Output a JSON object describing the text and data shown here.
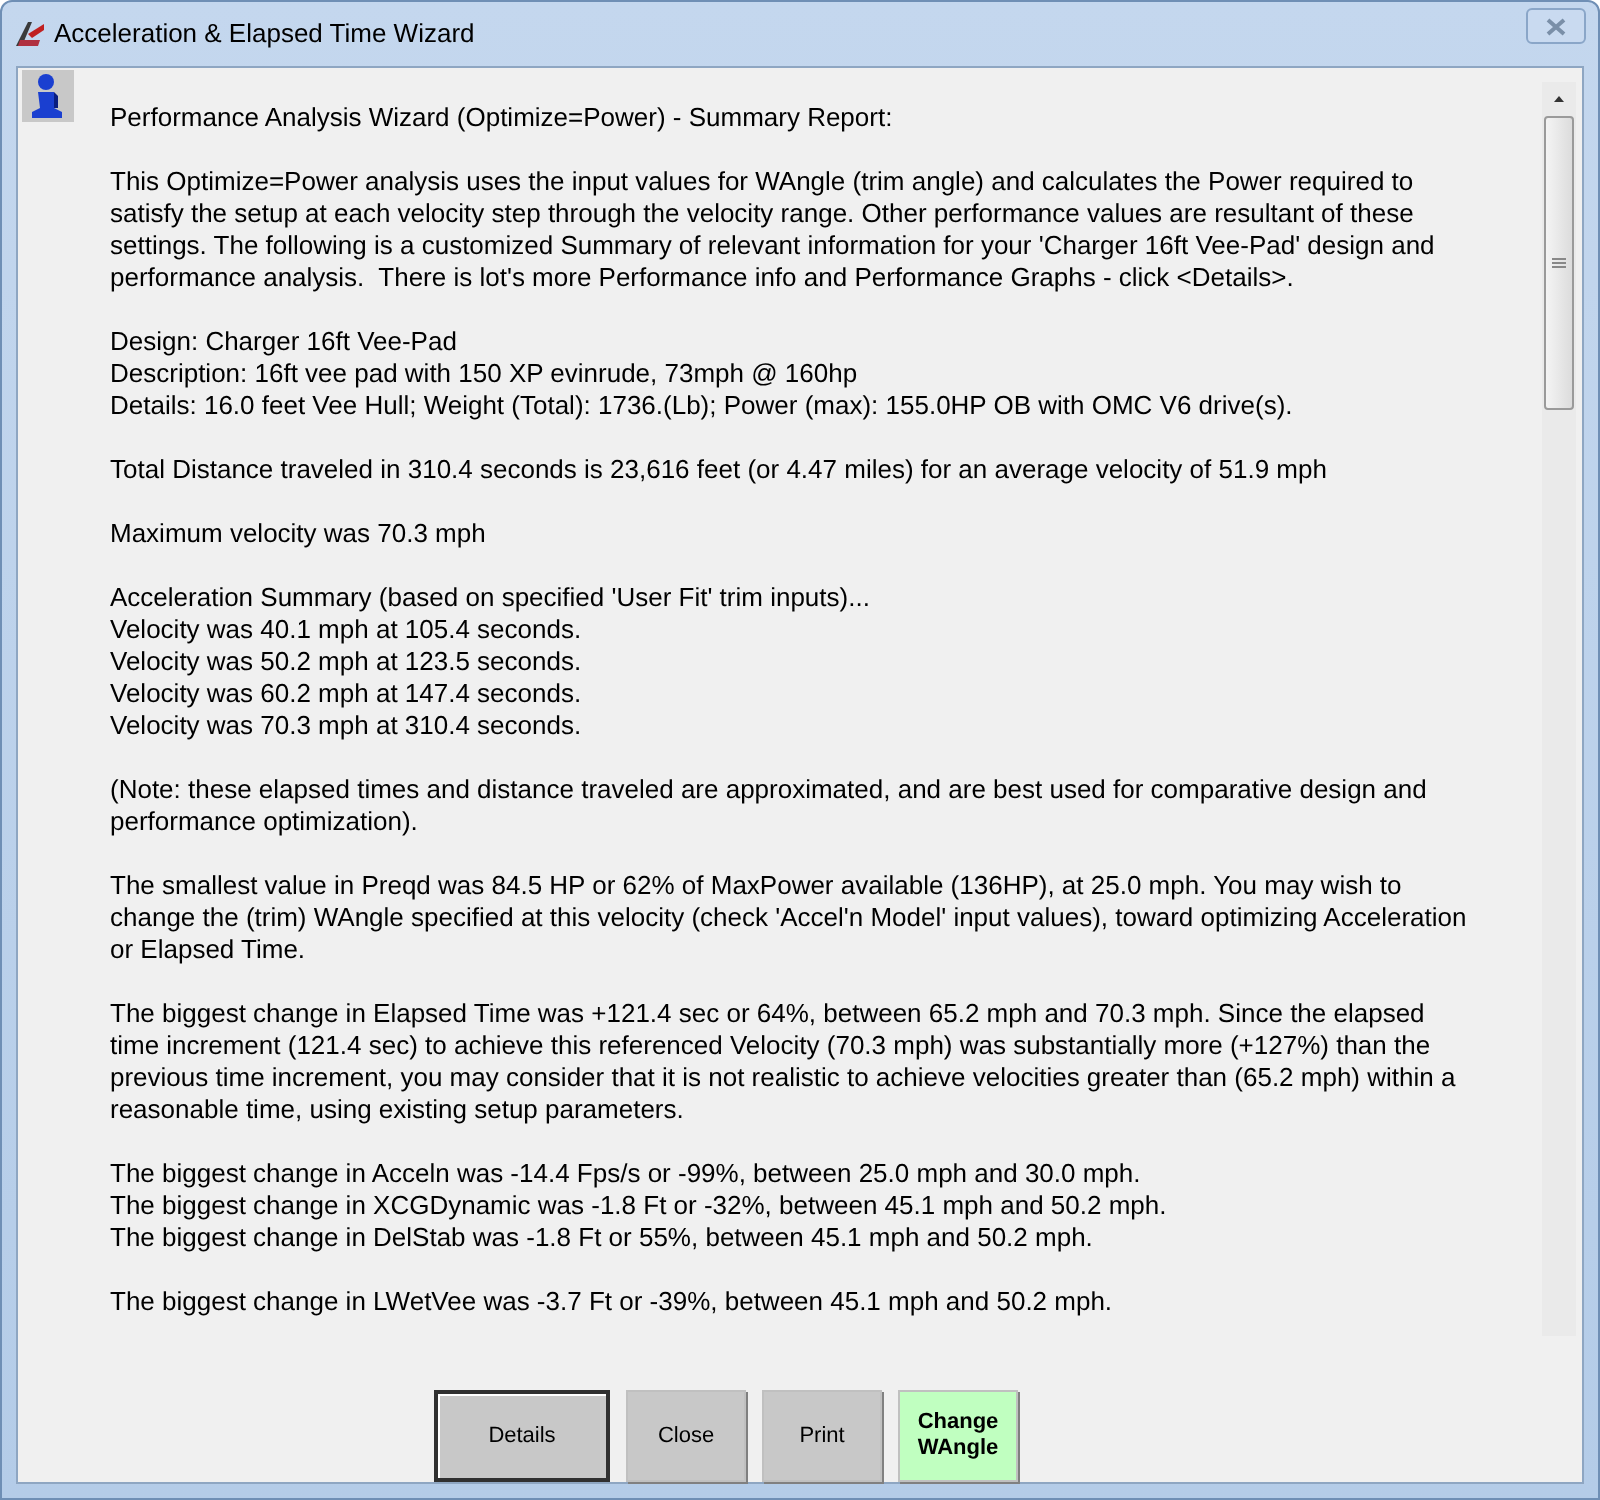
{
  "window": {
    "title": "Acceleration & Elapsed Time Wizard"
  },
  "report": {
    "paragraphs": [
      "Performance Analysis Wizard (Optimize=Power) - Summary Report:",
      "This Optimize=Power analysis uses the input values for WAngle (trim angle) and calculates the Power required to\nsatisfy the setup at each velocity step through the velocity range. Other performance values are resultant of these\nsettings. The following is a customized Summary of relevant information for your 'Charger 16ft Vee-Pad' design and\nperformance analysis.  There is lot's more Performance info and Performance Graphs - click <Details>.",
      "Design: Charger 16ft Vee-Pad\nDescription: 16ft vee pad with 150 XP evinrude, 73mph @ 160hp\nDetails: 16.0 feet Vee Hull; Weight (Total): 1736.(Lb); Power (max): 155.0HP OB with OMC V6 drive(s).",
      "Total Distance traveled in 310.4 seconds is 23,616 feet (or 4.47 miles) for an average velocity of 51.9 mph",
      "Maximum velocity was 70.3 mph",
      "Acceleration Summary (based on specified 'User Fit' trim inputs)...\nVelocity was 40.1 mph at 105.4 seconds.\nVelocity was 50.2 mph at 123.5 seconds.\nVelocity was 60.2 mph at 147.4 seconds.\nVelocity was 70.3 mph at 310.4 seconds.",
      "(Note: these elapsed times and distance traveled are approximated, and are best used for comparative design and\nperformance optimization).",
      "The smallest value in Preqd was 84.5 HP or 62% of MaxPower available (136HP), at 25.0 mph. You may wish to\nchange the (trim) WAngle specified at this velocity (check 'Accel'n Model' input values), toward optimizing Acceleration\nor Elapsed Time.",
      "The biggest change in Elapsed Time was +121.4 sec or 64%, between 65.2 mph and 70.3 mph. Since the elapsed\ntime increment (121.4 sec) to achieve this referenced Velocity (70.3 mph) was substantially more (+127%) than the\nprevious time increment, you may consider that it is not realistic to achieve velocities greater than (65.2 mph) within a\nreasonable time, using existing setup parameters.",
      "The biggest change in Acceln was -14.4 Fps/s or -99%, between 25.0 mph and 30.0 mph.\nThe biggest change in XCGDynamic was -1.8 Ft or -32%, between 45.1 mph and 50.2 mph.\nThe biggest change in DelStab was -1.8 Ft or 55%, between 45.1 mph and 50.2 mph.",
      "The biggest change in LWetVee was -3.7 Ft or -39%, between 45.1 mph and 50.2 mph."
    ]
  },
  "buttons": [
    {
      "label": "Details",
      "default": true,
      "color": "#c8c8c8"
    },
    {
      "label": "Close",
      "default": false,
      "color": "#c8c8c8"
    },
    {
      "label": "Print",
      "default": false,
      "color": "#c8c8c8"
    },
    {
      "label": "Change\nWAngle",
      "default": false,
      "color": "#c0ffc0"
    }
  ]
}
